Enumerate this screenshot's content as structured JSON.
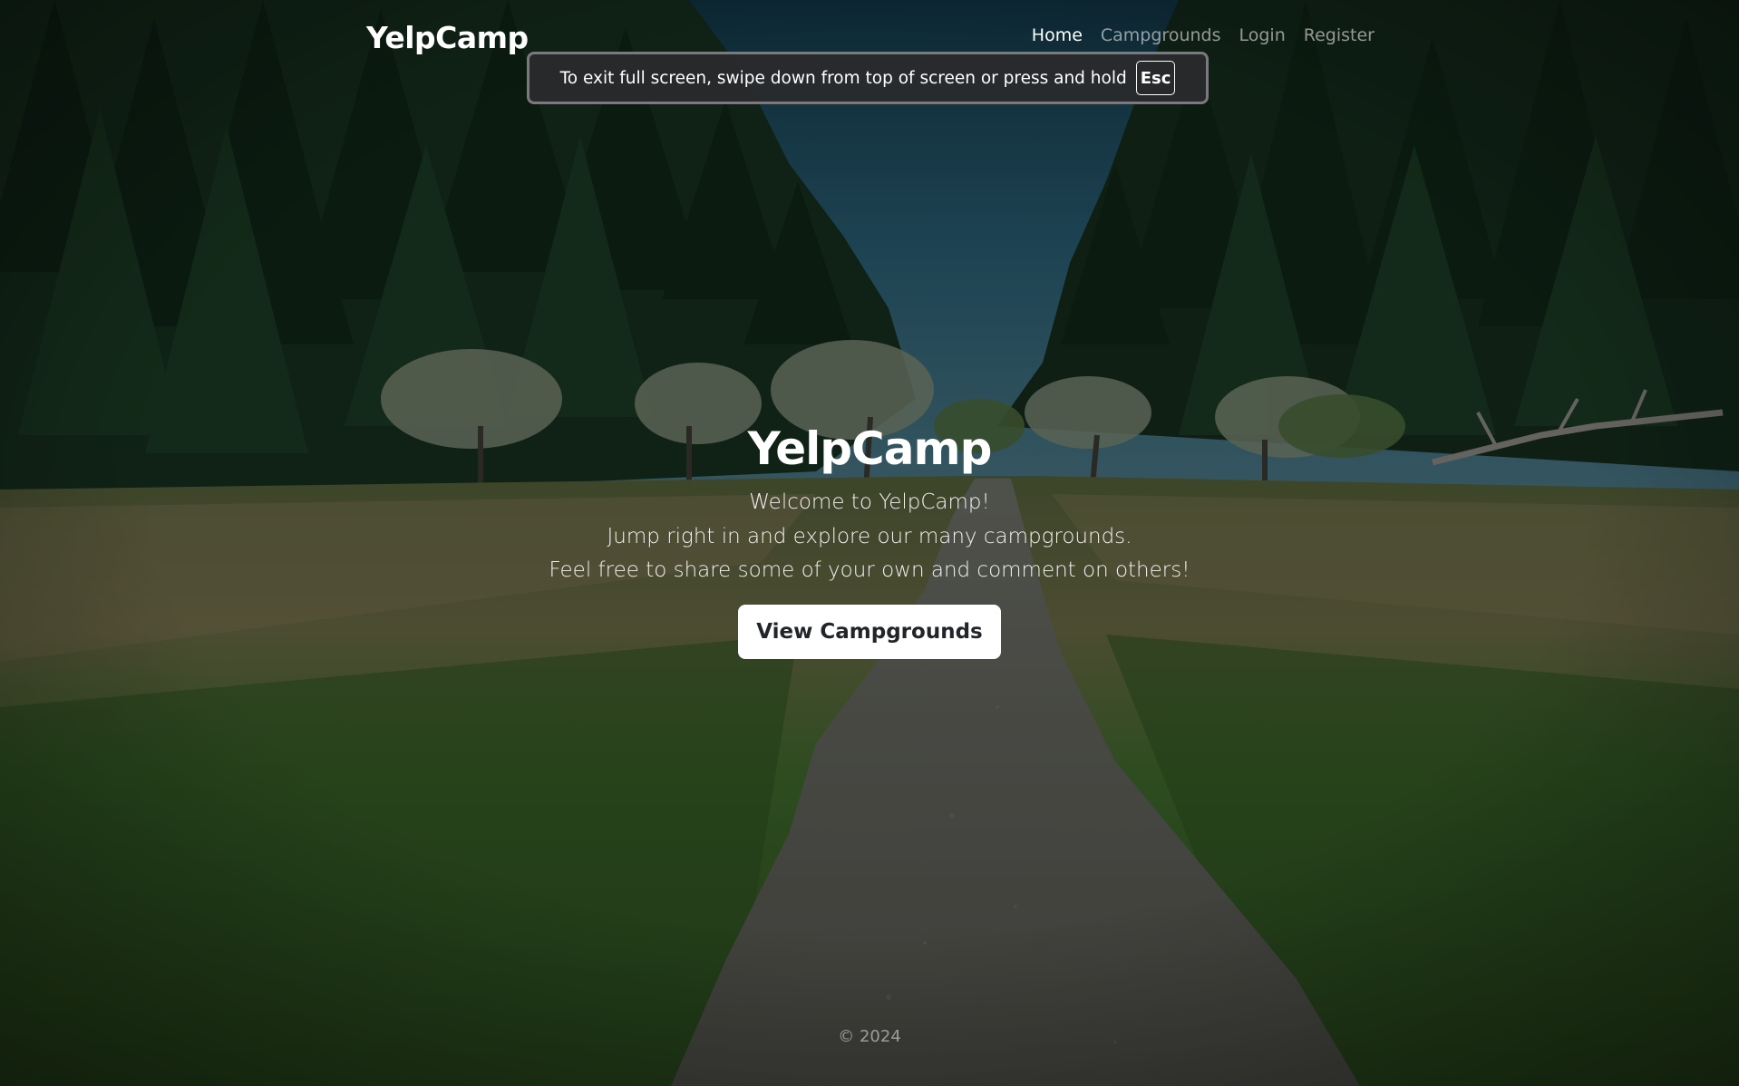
{
  "navbar": {
    "brand": "YelpCamp",
    "links": [
      {
        "label": "Home",
        "active": true
      },
      {
        "label": "Campgrounds",
        "active": false
      },
      {
        "label": "Login",
        "active": false
      },
      {
        "label": "Register",
        "active": false
      }
    ]
  },
  "fullscreen_notice": {
    "message": "To exit full screen, swipe down from top of screen or press and hold",
    "key": "Esc"
  },
  "hero": {
    "title": "YelpCamp",
    "lines": [
      "Welcome to YelpCamp!",
      "Jump right in and explore our many campgrounds.",
      "Feel free to share some of your own and comment on others!"
    ],
    "cta_label": "View Campgrounds"
  },
  "footer": {
    "text": "© 2024"
  },
  "colors": {
    "sky": "#1c4a5e",
    "forest": "#14271c",
    "grass": "#3d5a2c",
    "path": "#5a5a58",
    "button_bg": "#ffffff",
    "button_text": "#212529"
  }
}
